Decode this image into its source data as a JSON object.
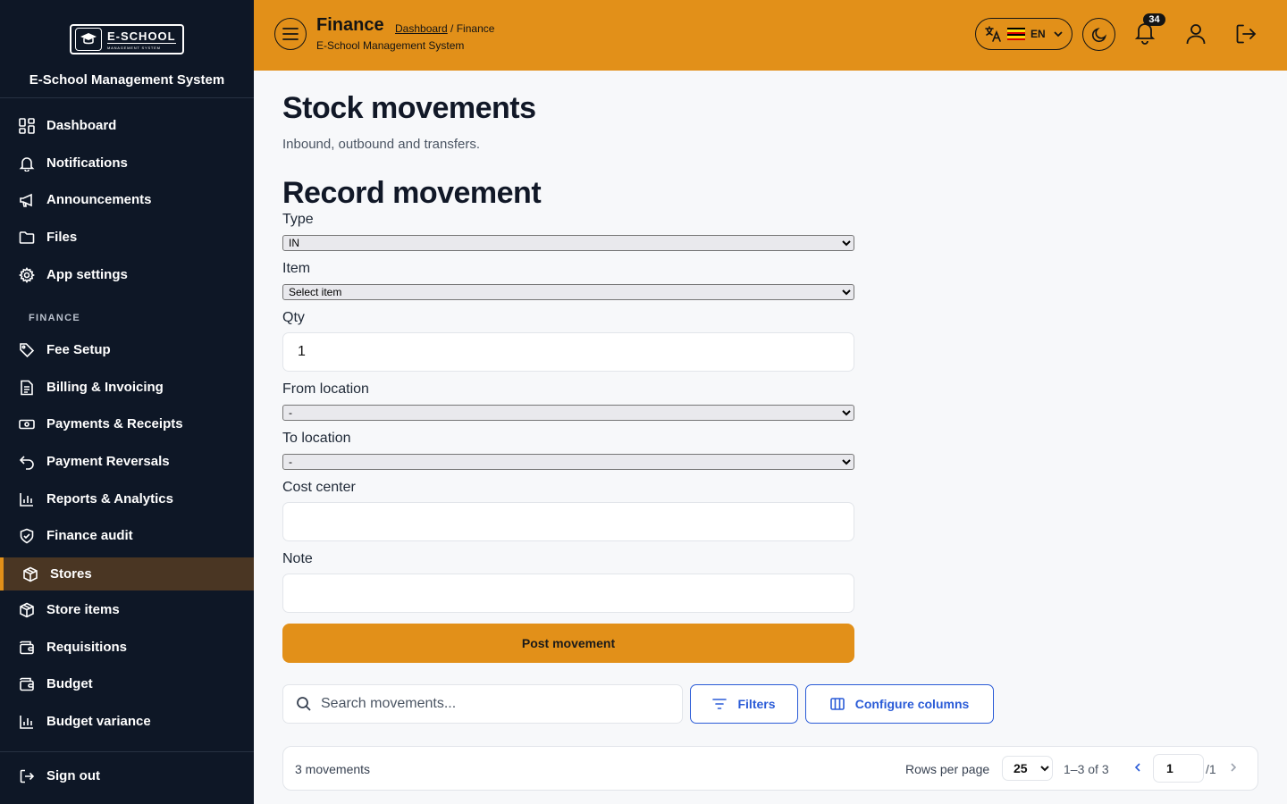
{
  "app": {
    "brand_name": "E-SCHOOL",
    "brand_tagline": "MANAGEMENT SYSTEM",
    "title": "E-School Management System"
  },
  "sidebar": {
    "items": [
      {
        "label": "Dashboard",
        "icon": "dashboard-icon"
      },
      {
        "label": "Notifications",
        "icon": "bell-icon"
      },
      {
        "label": "Announcements",
        "icon": "megaphone-icon"
      },
      {
        "label": "Files",
        "icon": "folder-icon"
      },
      {
        "label": "App settings",
        "icon": "gear-icon"
      }
    ],
    "section_label": "FINANCE",
    "finance_items": [
      {
        "label": "Fee Setup",
        "icon": "tag-icon"
      },
      {
        "label": "Billing & Invoicing",
        "icon": "invoice-icon"
      },
      {
        "label": "Payments & Receipts",
        "icon": "banknote-icon"
      },
      {
        "label": "Payment Reversals",
        "icon": "undo-icon"
      },
      {
        "label": "Reports & Analytics",
        "icon": "bar-chart-icon"
      },
      {
        "label": "Finance audit",
        "icon": "shield-check-icon"
      },
      {
        "label": "Stores",
        "icon": "box-icon",
        "active": true
      },
      {
        "label": "Store items",
        "icon": "box-icon"
      },
      {
        "label": "Requisitions",
        "icon": "wallet-icon"
      },
      {
        "label": "Budget",
        "icon": "wallet-icon"
      },
      {
        "label": "Budget variance",
        "icon": "bar-chart-icon"
      }
    ],
    "sign_out": "Sign out"
  },
  "header": {
    "title": "Finance",
    "breadcrumb_link": "Dashboard",
    "breadcrumb_current": " / Finance",
    "subtitle": "E-School Management System",
    "language_code": "EN",
    "notification_count": "34",
    "accent_color": "#e29019"
  },
  "page": {
    "title": "Stock movements",
    "subtitle": "Inbound, outbound and transfers."
  },
  "form": {
    "title": "Record movement",
    "type_label": "Type",
    "type_value": "IN",
    "item_label": "Item",
    "item_value": "Select item",
    "qty_label": "Qty",
    "qty_value": "1",
    "from_label": "From location",
    "from_value": "-",
    "to_label": "To location",
    "to_value": "-",
    "cost_center_label": "Cost center",
    "cost_center_value": "",
    "note_label": "Note",
    "note_value": "",
    "submit_label": "Post movement"
  },
  "toolbar": {
    "search_placeholder": "Search movements...",
    "filters_label": "Filters",
    "configure_label": "Configure columns"
  },
  "table": {
    "count_text": "3 movements",
    "rows_per_page_label": "Rows per page",
    "rows_per_page_value": "25",
    "range_text": "1–3 of 3",
    "page_value": "1",
    "page_total": "/1"
  }
}
